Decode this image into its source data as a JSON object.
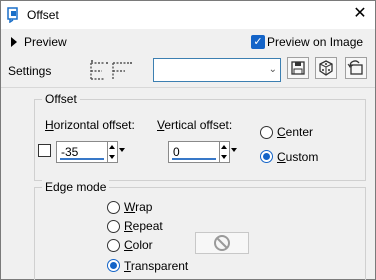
{
  "window": {
    "title": "Offset",
    "close_symbol": "✕",
    "app_icon": "paint-app-icon"
  },
  "preview_bar": {
    "toggle_label": "Preview",
    "preview_on_image_label": "Preview on Image",
    "preview_on_image_checked": true
  },
  "settings": {
    "label": "Settings",
    "preset_value": "",
    "buttons": [
      "save-preset-icon",
      "randomize-dice-icon",
      "reset-icon"
    ]
  },
  "offset_group": {
    "title": "Offset",
    "horizontal_label_prefix": "H",
    "horizontal_label_rest": "orizontal offset:",
    "vertical_label_prefix": "V",
    "vertical_label_rest": "ertical offset:",
    "horizontal_value": "-35",
    "vertical_value": "0",
    "center_label_prefix": "C",
    "center_label_rest": "enter",
    "custom_label_prefix": "C",
    "custom_label_rest": "ustom",
    "selected": "custom",
    "link_checked": false
  },
  "edge_mode_group": {
    "title": "Edge mode",
    "options": [
      {
        "prefix": "W",
        "rest": "rap",
        "selected": false
      },
      {
        "prefix": "R",
        "rest": "epeat",
        "selected": false
      },
      {
        "prefix": "C",
        "rest": "olor",
        "selected": false
      },
      {
        "prefix": "T",
        "rest": "ransparent",
        "selected": true
      }
    ],
    "color_swatch_icon": "no-color-icon"
  }
}
